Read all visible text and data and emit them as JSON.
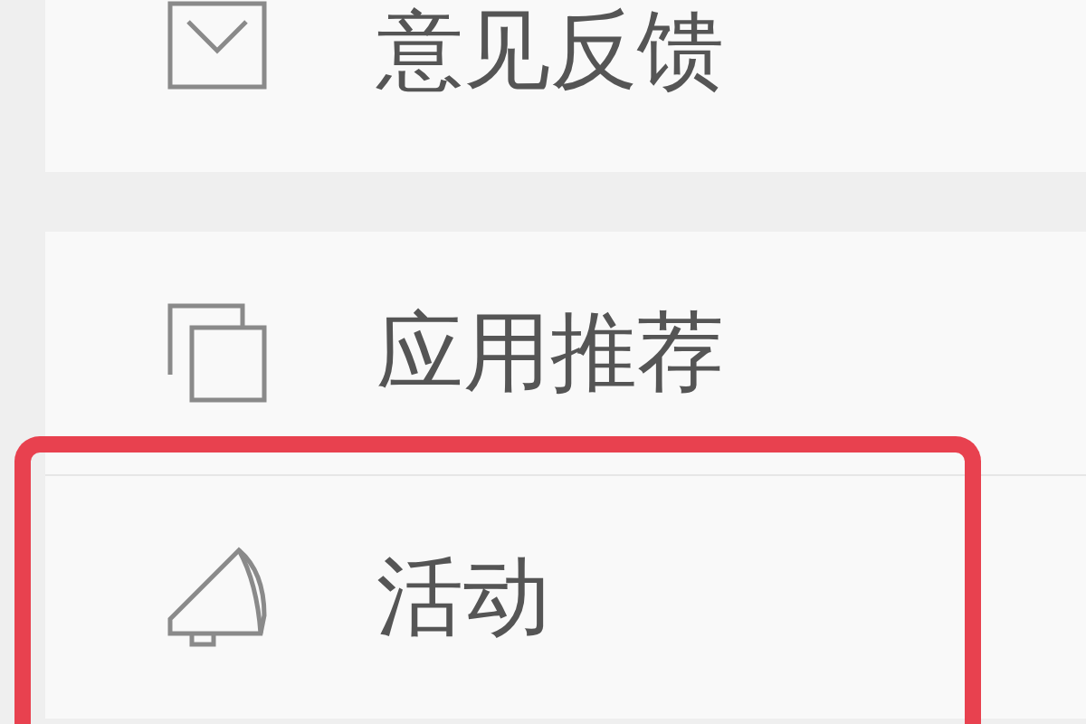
{
  "menu": {
    "groups": [
      {
        "items": [
          {
            "label": "意见反馈",
            "kind": "mail",
            "highlighted": false
          }
        ]
      },
      {
        "items": [
          {
            "label": "应用推荐",
            "kind": "apps",
            "highlighted": false
          },
          {
            "label": "活动",
            "kind": "megaphone",
            "highlighted": true
          }
        ]
      }
    ]
  }
}
